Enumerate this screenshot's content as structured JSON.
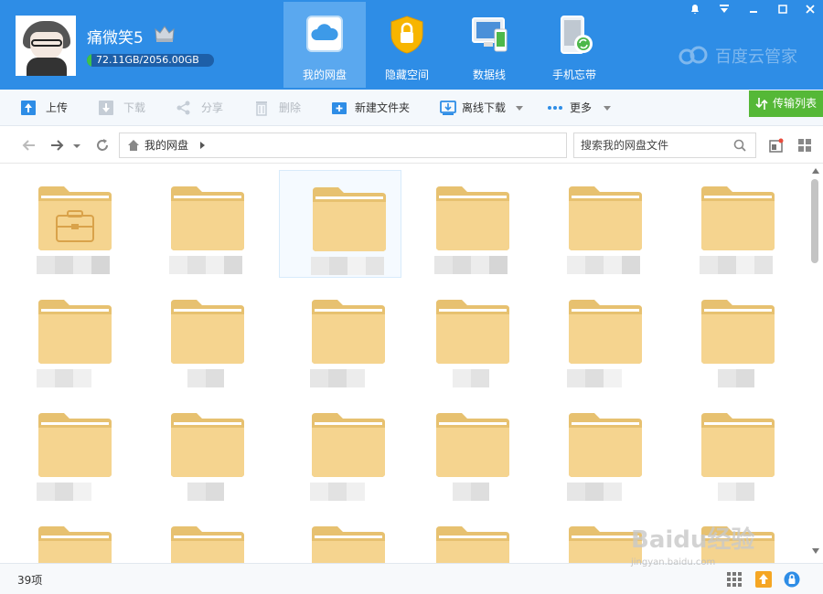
{
  "header": {
    "username": "痛微笑5",
    "quota": {
      "text": "72.11GB/2056.00GB",
      "used_fraction": 0.035
    },
    "tabs": [
      {
        "label": "我的网盘",
        "icon": "cloud-icon",
        "active": true
      },
      {
        "label": "隐藏空间",
        "icon": "lock-icon",
        "active": false
      },
      {
        "label": "数据线",
        "icon": "devices-icon",
        "active": false
      },
      {
        "label": "手机忘带",
        "icon": "phone-sync-icon",
        "active": false
      }
    ],
    "brand": "百度云管家"
  },
  "toolbar": {
    "upload": "上传",
    "download": "下载",
    "share": "分享",
    "delete": "删除",
    "new_folder": "新建文件夹",
    "offline_download": "离线下载",
    "more": "更多",
    "transfer_list": "传输列表"
  },
  "address": {
    "path": "我的网盘",
    "search_placeholder": "搜索我的网盘文件"
  },
  "files": {
    "rows": 4,
    "columns": 6,
    "special_first": "briefcase-folder-icon",
    "selected_index": 2
  },
  "status": {
    "count": "39项"
  },
  "watermark": {
    "main": "Baidu经验",
    "sub": "jingyan.baidu.com"
  },
  "colors": {
    "header_bg": "#2e8de6",
    "active_tab": "#5aa8ef",
    "toolbar_bg": "#f4f8fc",
    "transfer_green": "#55b837",
    "folder": "#f5d48f"
  }
}
